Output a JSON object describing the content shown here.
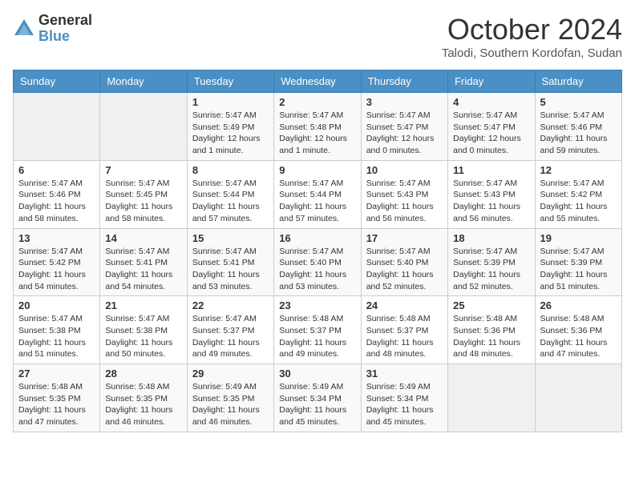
{
  "header": {
    "logo_general": "General",
    "logo_blue": "Blue",
    "month_title": "October 2024",
    "subtitle": "Talodi, Southern Kordofan, Sudan"
  },
  "weekdays": [
    "Sunday",
    "Monday",
    "Tuesday",
    "Wednesday",
    "Thursday",
    "Friday",
    "Saturday"
  ],
  "weeks": [
    [
      {
        "day": "",
        "content": ""
      },
      {
        "day": "",
        "content": ""
      },
      {
        "day": "1",
        "content": "Sunrise: 5:47 AM\nSunset: 5:49 PM\nDaylight: 12 hours and 1 minute."
      },
      {
        "day": "2",
        "content": "Sunrise: 5:47 AM\nSunset: 5:48 PM\nDaylight: 12 hours and 1 minute."
      },
      {
        "day": "3",
        "content": "Sunrise: 5:47 AM\nSunset: 5:47 PM\nDaylight: 12 hours and 0 minutes."
      },
      {
        "day": "4",
        "content": "Sunrise: 5:47 AM\nSunset: 5:47 PM\nDaylight: 12 hours and 0 minutes."
      },
      {
        "day": "5",
        "content": "Sunrise: 5:47 AM\nSunset: 5:46 PM\nDaylight: 11 hours and 59 minutes."
      }
    ],
    [
      {
        "day": "6",
        "content": "Sunrise: 5:47 AM\nSunset: 5:46 PM\nDaylight: 11 hours and 58 minutes."
      },
      {
        "day": "7",
        "content": "Sunrise: 5:47 AM\nSunset: 5:45 PM\nDaylight: 11 hours and 58 minutes."
      },
      {
        "day": "8",
        "content": "Sunrise: 5:47 AM\nSunset: 5:44 PM\nDaylight: 11 hours and 57 minutes."
      },
      {
        "day": "9",
        "content": "Sunrise: 5:47 AM\nSunset: 5:44 PM\nDaylight: 11 hours and 57 minutes."
      },
      {
        "day": "10",
        "content": "Sunrise: 5:47 AM\nSunset: 5:43 PM\nDaylight: 11 hours and 56 minutes."
      },
      {
        "day": "11",
        "content": "Sunrise: 5:47 AM\nSunset: 5:43 PM\nDaylight: 11 hours and 56 minutes."
      },
      {
        "day": "12",
        "content": "Sunrise: 5:47 AM\nSunset: 5:42 PM\nDaylight: 11 hours and 55 minutes."
      }
    ],
    [
      {
        "day": "13",
        "content": "Sunrise: 5:47 AM\nSunset: 5:42 PM\nDaylight: 11 hours and 54 minutes."
      },
      {
        "day": "14",
        "content": "Sunrise: 5:47 AM\nSunset: 5:41 PM\nDaylight: 11 hours and 54 minutes."
      },
      {
        "day": "15",
        "content": "Sunrise: 5:47 AM\nSunset: 5:41 PM\nDaylight: 11 hours and 53 minutes."
      },
      {
        "day": "16",
        "content": "Sunrise: 5:47 AM\nSunset: 5:40 PM\nDaylight: 11 hours and 53 minutes."
      },
      {
        "day": "17",
        "content": "Sunrise: 5:47 AM\nSunset: 5:40 PM\nDaylight: 11 hours and 52 minutes."
      },
      {
        "day": "18",
        "content": "Sunrise: 5:47 AM\nSunset: 5:39 PM\nDaylight: 11 hours and 52 minutes."
      },
      {
        "day": "19",
        "content": "Sunrise: 5:47 AM\nSunset: 5:39 PM\nDaylight: 11 hours and 51 minutes."
      }
    ],
    [
      {
        "day": "20",
        "content": "Sunrise: 5:47 AM\nSunset: 5:38 PM\nDaylight: 11 hours and 51 minutes."
      },
      {
        "day": "21",
        "content": "Sunrise: 5:47 AM\nSunset: 5:38 PM\nDaylight: 11 hours and 50 minutes."
      },
      {
        "day": "22",
        "content": "Sunrise: 5:47 AM\nSunset: 5:37 PM\nDaylight: 11 hours and 49 minutes."
      },
      {
        "day": "23",
        "content": "Sunrise: 5:48 AM\nSunset: 5:37 PM\nDaylight: 11 hours and 49 minutes."
      },
      {
        "day": "24",
        "content": "Sunrise: 5:48 AM\nSunset: 5:37 PM\nDaylight: 11 hours and 48 minutes."
      },
      {
        "day": "25",
        "content": "Sunrise: 5:48 AM\nSunset: 5:36 PM\nDaylight: 11 hours and 48 minutes."
      },
      {
        "day": "26",
        "content": "Sunrise: 5:48 AM\nSunset: 5:36 PM\nDaylight: 11 hours and 47 minutes."
      }
    ],
    [
      {
        "day": "27",
        "content": "Sunrise: 5:48 AM\nSunset: 5:35 PM\nDaylight: 11 hours and 47 minutes."
      },
      {
        "day": "28",
        "content": "Sunrise: 5:48 AM\nSunset: 5:35 PM\nDaylight: 11 hours and 46 minutes."
      },
      {
        "day": "29",
        "content": "Sunrise: 5:49 AM\nSunset: 5:35 PM\nDaylight: 11 hours and 46 minutes."
      },
      {
        "day": "30",
        "content": "Sunrise: 5:49 AM\nSunset: 5:34 PM\nDaylight: 11 hours and 45 minutes."
      },
      {
        "day": "31",
        "content": "Sunrise: 5:49 AM\nSunset: 5:34 PM\nDaylight: 11 hours and 45 minutes."
      },
      {
        "day": "",
        "content": ""
      },
      {
        "day": "",
        "content": ""
      }
    ]
  ]
}
